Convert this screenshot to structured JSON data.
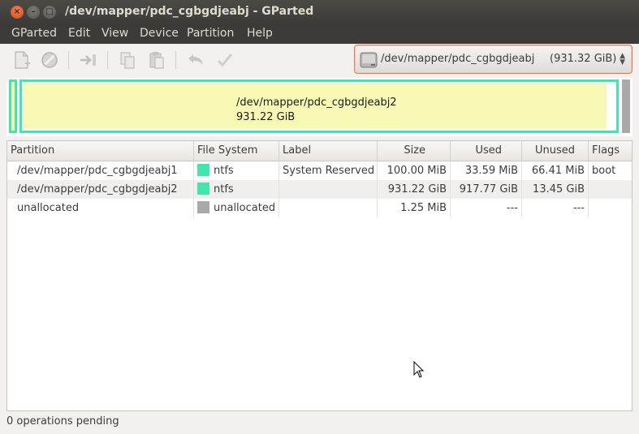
{
  "window": {
    "title": "/dev/mapper/pdc_cgbgdjeabj - GParted"
  },
  "menu": [
    "GParted",
    "Edit",
    "View",
    "Device",
    "Partition",
    "Help"
  ],
  "device_selector": {
    "device": "/dev/mapper/pdc_cgbgdjeabj",
    "size": "(931.32 GiB)"
  },
  "visual": {
    "selected_name": "/dev/mapper/pdc_cgbgdjeabj2",
    "selected_size": "931.22 GiB"
  },
  "table": {
    "headers": [
      "Partition",
      "File System",
      "Label",
      "Size",
      "Used",
      "Unused",
      "Flags"
    ],
    "rows": [
      {
        "partition": "/dev/mapper/pdc_cgbgdjeabj1",
        "fs": "ntfs",
        "fs_color": "#42e5ac",
        "label": "System Reserved",
        "size": "100.00 MiB",
        "used": "33.59 MiB",
        "unused": "66.41 MiB",
        "flags": "boot"
      },
      {
        "partition": "/dev/mapper/pdc_cgbgdjeabj2",
        "fs": "ntfs",
        "fs_color": "#42e5ac",
        "label": "",
        "size": "931.22 GiB",
        "used": "917.77 GiB",
        "unused": "13.45 GiB",
        "flags": ""
      },
      {
        "partition": "unallocated",
        "fs": "unallocated",
        "fs_color": "#a9a9a9",
        "label": "",
        "size": "1.25 MiB",
        "used": "---",
        "unused": "---",
        "flags": ""
      }
    ]
  },
  "status": {
    "text": "0 operations pending"
  },
  "colors": {
    "ntfs": "#42e5ac",
    "unallocated": "#a9a9a9",
    "partition_fill": "#f8f8b5",
    "focus": "#e07a55"
  },
  "icons": [
    "new-partition-icon",
    "delete-icon",
    "resize-move-icon",
    "copy-icon",
    "paste-icon",
    "undo-icon",
    "apply-icon",
    "disk-icon"
  ]
}
